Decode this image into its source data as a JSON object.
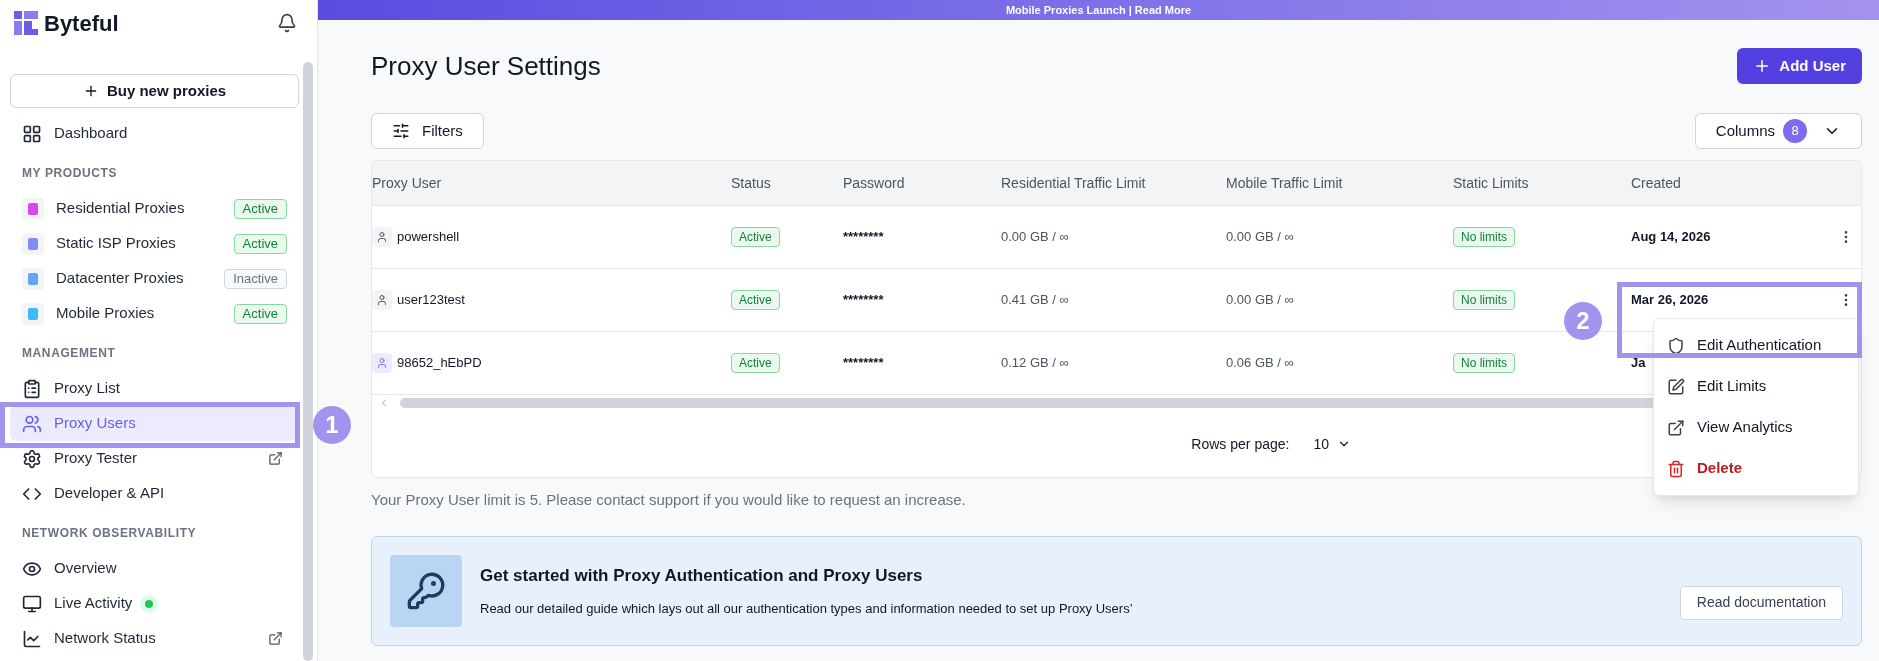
{
  "banner": {
    "text": "Mobile Proxies Launch | Read More"
  },
  "sidebar": {
    "logo": "Byteful",
    "buy_button": "Buy new proxies",
    "sections": [
      {
        "items": [
          {
            "label": "Dashboard",
            "selected": false,
            "external": false
          }
        ]
      },
      {
        "heading": "MY PRODUCTS",
        "items": [
          {
            "label": "Residential Proxies",
            "badge": "Active",
            "active": true,
            "color": "#d946ef",
            "selected": false,
            "external": false
          },
          {
            "label": "Static ISP Proxies",
            "badge": "Active",
            "active": true,
            "color": "#818cf8",
            "selected": false,
            "external": false
          },
          {
            "label": "Datacenter Proxies",
            "badge": "Inactive",
            "active": false,
            "color": "#60a5fa",
            "selected": false,
            "external": false
          },
          {
            "label": "Mobile Proxies",
            "badge": "Active",
            "active": true,
            "color": "#38bdf8",
            "selected": false,
            "external": false
          }
        ]
      },
      {
        "heading": "MANAGEMENT",
        "items": [
          {
            "label": "Proxy List",
            "selected": false,
            "external": false
          },
          {
            "label": "Proxy Users",
            "selected": true,
            "external": false
          },
          {
            "label": "Proxy Tester",
            "selected": false,
            "external": true
          },
          {
            "label": "Developer & API",
            "selected": false,
            "external": false
          }
        ]
      },
      {
        "heading": "NETWORK OBSERVABILITY",
        "items": [
          {
            "label": "Overview",
            "selected": false,
            "external": false
          },
          {
            "label": "Live Activity",
            "selected": false,
            "external": false,
            "live": true
          },
          {
            "label": "Network Status",
            "selected": false,
            "external": true
          }
        ]
      }
    ]
  },
  "page": {
    "title": "Proxy User Settings",
    "add_button": "Add User",
    "filters_button": "Filters",
    "columns_button": {
      "label": "Columns",
      "count": "8"
    }
  },
  "table": {
    "columns": [
      "Proxy User",
      "Status",
      "Password",
      "Residential Traffic Limit",
      "Mobile Traffic Limit",
      "Static Limits",
      "Created"
    ],
    "rows": [
      {
        "user": "powershell",
        "icon_highlighted": false,
        "status": "Active",
        "password": "********",
        "residential": "0.00 GB / ∞",
        "mobile": "0.00 GB / ∞",
        "static": "No limits",
        "created": "Aug 14, 2026"
      },
      {
        "user": "user123test",
        "icon_highlighted": false,
        "status": "Active",
        "password": "********",
        "residential": "0.41 GB / ∞",
        "mobile": "0.00 GB / ∞",
        "static": "No limits",
        "created": "Mar 26, 2026"
      },
      {
        "user": "98652_hEbPD",
        "icon_highlighted": true,
        "status": "Active",
        "password": "********",
        "residential": "0.12 GB / ∞",
        "mobile": "0.06 GB / ∞",
        "static": "No limits",
        "created": "Ja"
      }
    ],
    "rows_per_page_label": "Rows per page:",
    "rows_per_page": "10"
  },
  "menu": {
    "items": [
      {
        "label": "Edit Authentication",
        "kind": "normal"
      },
      {
        "label": "Edit Limits",
        "kind": "normal"
      },
      {
        "label": "View Analytics",
        "kind": "normal"
      },
      {
        "label": "Delete",
        "kind": "danger"
      }
    ]
  },
  "limit_note": "Your Proxy User limit is 5. Please contact support if you would like to request an increase.",
  "info_card": {
    "title": "Get started with Proxy Authentication and Proxy Users",
    "text": "Read our detailed guide which lays out all our authentication types and information needed to set up Proxy Users’",
    "button": "Read documentation"
  },
  "annotations": [
    {
      "number": "1"
    },
    {
      "number": "2"
    }
  ]
}
